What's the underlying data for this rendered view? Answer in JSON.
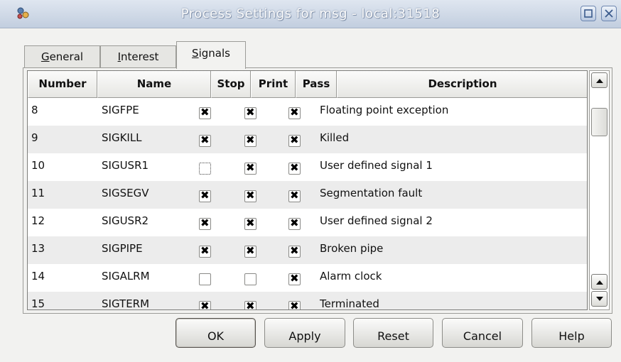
{
  "window": {
    "title": "Process Settings for msg - local:31518",
    "maximize_icon": "maximize-icon",
    "close_icon": "close-icon"
  },
  "tabs": [
    {
      "label": "General",
      "mnemonic": "G",
      "active": false
    },
    {
      "label": "Interest",
      "mnemonic": "I",
      "active": false
    },
    {
      "label": "Signals",
      "mnemonic": "S",
      "active": true
    }
  ],
  "signals_table": {
    "columns": [
      "Number",
      "Name",
      "Stop",
      "Print",
      "Pass",
      "Description"
    ],
    "rows": [
      {
        "number": "8",
        "name": "SIGFPE",
        "stop": true,
        "print": true,
        "pass": true,
        "description": "Floating point exception"
      },
      {
        "number": "9",
        "name": "SIGKILL",
        "stop": true,
        "print": true,
        "pass": true,
        "description": "Killed"
      },
      {
        "number": "10",
        "name": "SIGUSR1",
        "stop": false,
        "print": true,
        "pass": true,
        "description": "User defined signal 1"
      },
      {
        "number": "11",
        "name": "SIGSEGV",
        "stop": true,
        "print": true,
        "pass": true,
        "description": "Segmentation fault"
      },
      {
        "number": "12",
        "name": "SIGUSR2",
        "stop": true,
        "print": true,
        "pass": true,
        "description": "User defined signal 2"
      },
      {
        "number": "13",
        "name": "SIGPIPE",
        "stop": true,
        "print": true,
        "pass": true,
        "description": "Broken pipe"
      },
      {
        "number": "14",
        "name": "SIGALRM",
        "stop": false,
        "print": false,
        "pass": true,
        "description": "Alarm clock"
      },
      {
        "number": "15",
        "name": "SIGTERM",
        "stop": true,
        "print": true,
        "pass": true,
        "description": "Terminated"
      }
    ]
  },
  "buttons": {
    "ok": "OK",
    "apply": "Apply",
    "reset": "Reset",
    "cancel": "Cancel",
    "help": "Help"
  }
}
